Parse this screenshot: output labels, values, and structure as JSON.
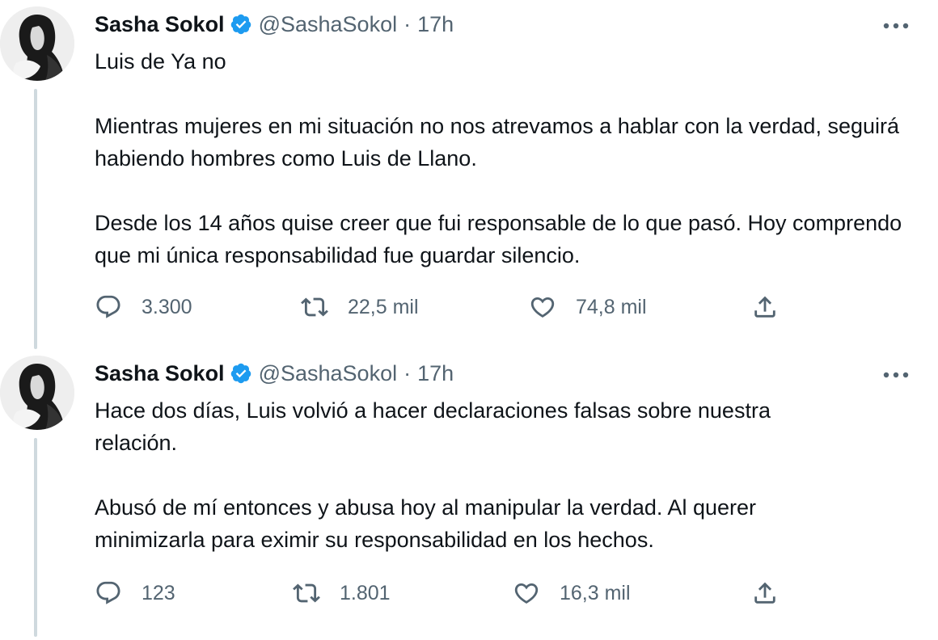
{
  "tweets": [
    {
      "display_name": "Sasha Sokol",
      "handle": "@SashaSokol",
      "separator": "·",
      "time": "17h",
      "paragraphs": [
        "Luis de Ya no",
        "Mientras mujeres en mi situación no nos atrevamos a hablar con la verdad, seguirá habiendo hombres como Luis de Llano.",
        "Desde los 14 años quise creer que fui responsable de lo que pasó. Hoy comprendo que mi única responsabilidad fue guardar silencio."
      ],
      "replies": "3.300",
      "retweets": "22,5 mil",
      "likes": "74,8 mil"
    },
    {
      "display_name": "Sasha Sokol",
      "handle": "@SashaSokol",
      "separator": "·",
      "time": "17h",
      "paragraphs": [
        "Hace dos días, Luis volvió a hacer declaraciones falsas sobre nuestra relación.",
        "Abusó de mí entonces y abusa hoy al manipular la verdad. Al querer minimizarla para eximir su responsabilidad en los hechos."
      ],
      "replies": "123",
      "retweets": "1.801",
      "likes": "16,3 mil"
    }
  ],
  "colors": {
    "text": "#0f1419",
    "secondary": "#536471",
    "verified": "#1d9bf0",
    "thread_line": "#cfd9de"
  },
  "icons": [
    "verified-badge-icon",
    "more-icon",
    "reply-icon",
    "retweet-icon",
    "like-icon",
    "share-icon"
  ]
}
